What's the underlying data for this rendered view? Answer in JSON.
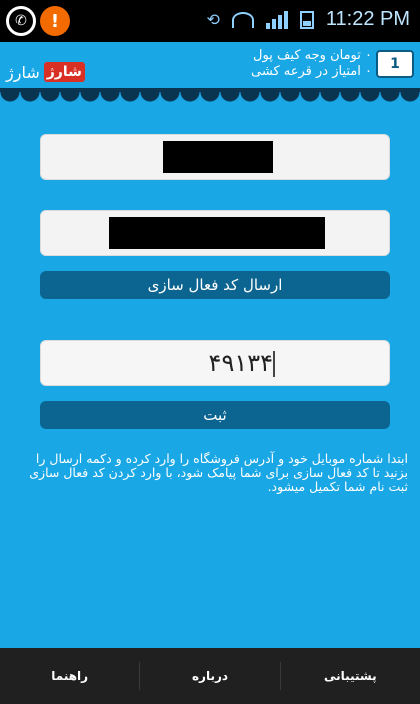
{
  "status_bar": {
    "time": "11:22 PM",
    "left_icons": [
      "viber-icon",
      "alert-icon"
    ],
    "right_icons": [
      "sync-icon",
      "wifi-icon",
      "signal-icon",
      "battery-icon"
    ]
  },
  "header": {
    "wallet_line": "۰ تومان وجه کیف پول",
    "points_line": "۰ امتیاز در قرعه کشی",
    "brand_badge": "شارژ",
    "brand_text": "شارژ"
  },
  "form": {
    "send_code_label": "ارسال کد فعال سازی",
    "activation_code_value": "۴۹۱۳۴",
    "submit_label": "ثبت"
  },
  "help_text": "ابتدا شماره موبایل خود و آدرس فروشگاه را وارد کرده و دکمه ارسال را بزنید تا کد فعال سازی برای شما پیامک شود، با وارد کردن کد فعال سازی ثبت نام شما تکمیل میشود.",
  "bottom_nav": {
    "left": "راهنما",
    "middle": "درباره",
    "right": "پشتیبانی"
  },
  "colors": {
    "background": "#1aa7e6",
    "button": "#0c6591",
    "nav": "#202020",
    "brand_badge": "#d93025"
  }
}
